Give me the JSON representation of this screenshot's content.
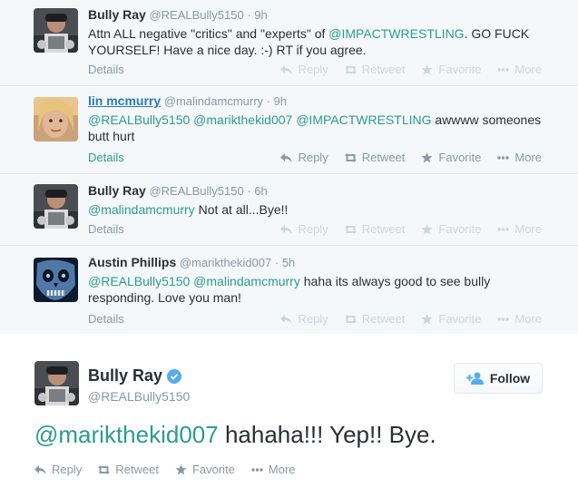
{
  "thread": [
    {
      "fullname": "Bully Ray",
      "username": "@REALBully5150",
      "sep": "·",
      "time": "9h",
      "text_parts": [
        {
          "type": "text",
          "value": "Attn ALL negative \"critics\" and \"experts\" of "
        },
        {
          "type": "mention",
          "value": "@IMPACTWRESTLING"
        },
        {
          "type": "text",
          "value": ". GO FUCK YOURSELF! Have a nice day. :-) RT if you agree."
        }
      ],
      "details": "Details",
      "actions": {
        "reply": "Reply",
        "retweet": "Retweet",
        "favorite": "Favorite",
        "more": "More"
      }
    },
    {
      "fullname": "lin mcmurry",
      "username": "@malindamcmurry",
      "sep": "·",
      "time": "9h",
      "text_parts": [
        {
          "type": "mention",
          "value": "@REALBully5150"
        },
        {
          "type": "text",
          "value": " "
        },
        {
          "type": "mention",
          "value": "@marikthekid007"
        },
        {
          "type": "text",
          "value": " "
        },
        {
          "type": "mention",
          "value": "@IMPACTWRESTLING"
        },
        {
          "type": "text",
          "value": " awwww someones butt hurt"
        }
      ],
      "details": "Details",
      "actions": {
        "reply": "Reply",
        "retweet": "Retweet",
        "favorite": "Favorite",
        "more": "More"
      }
    },
    {
      "fullname": "Bully Ray",
      "username": "@REALBully5150",
      "sep": "·",
      "time": "6h",
      "text_parts": [
        {
          "type": "mention",
          "value": "@malindamcmurry"
        },
        {
          "type": "text",
          "value": " Not at all...Bye!!"
        }
      ],
      "details": "Details",
      "actions": {
        "reply": "Reply",
        "retweet": "Retweet",
        "favorite": "Favorite",
        "more": "More"
      }
    },
    {
      "fullname": "Austin Phillips",
      "username": "@marikthekid007",
      "sep": "·",
      "time": "5h",
      "text_parts": [
        {
          "type": "mention",
          "value": "@REALBully5150"
        },
        {
          "type": "text",
          "value": " "
        },
        {
          "type": "mention",
          "value": "@malindamcmurry"
        },
        {
          "type": "text",
          "value": " haha its always good to see bully responding. Love you man!"
        }
      ],
      "details": "Details",
      "actions": {
        "reply": "Reply",
        "retweet": "Retweet",
        "favorite": "Favorite",
        "more": "More"
      }
    }
  ],
  "expanded": {
    "fullname": "Bully Ray",
    "username": "@REALBully5150",
    "follow_label": "Follow",
    "mention": "@marikthekid007",
    "text": " hahaha!!!  Yep!!  Bye.",
    "actions": {
      "reply": "Reply",
      "retweet": "Retweet",
      "favorite": "Favorite",
      "more": "More"
    }
  },
  "colors": {
    "mention": "#2b9c8f",
    "verified": "#55acee",
    "muted": "#8899a6",
    "background": "#f5f8fa"
  },
  "icons": [
    "reply-icon",
    "retweet-icon",
    "favorite-icon",
    "more-icon",
    "verified-icon",
    "follow-user-icon"
  ]
}
